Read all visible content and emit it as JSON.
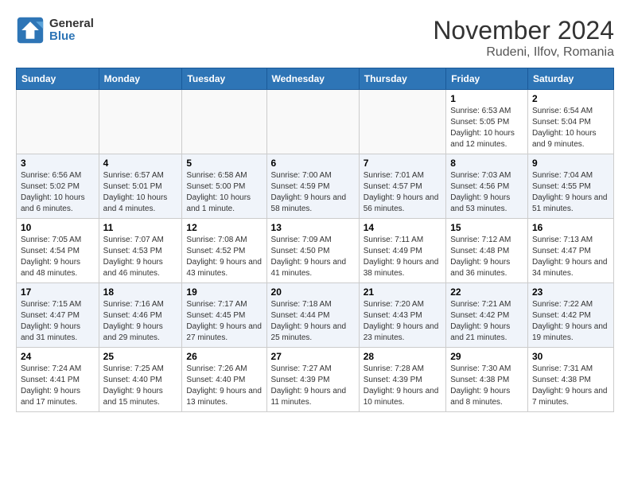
{
  "logo": {
    "text_general": "General",
    "text_blue": "Blue"
  },
  "title": "November 2024",
  "location": "Rudeni, Ilfov, Romania",
  "headers": [
    "Sunday",
    "Monday",
    "Tuesday",
    "Wednesday",
    "Thursday",
    "Friday",
    "Saturday"
  ],
  "weeks": [
    [
      {
        "day": "",
        "info": ""
      },
      {
        "day": "",
        "info": ""
      },
      {
        "day": "",
        "info": ""
      },
      {
        "day": "",
        "info": ""
      },
      {
        "day": "",
        "info": ""
      },
      {
        "day": "1",
        "info": "Sunrise: 6:53 AM\nSunset: 5:05 PM\nDaylight: 10 hours and 12 minutes."
      },
      {
        "day": "2",
        "info": "Sunrise: 6:54 AM\nSunset: 5:04 PM\nDaylight: 10 hours and 9 minutes."
      }
    ],
    [
      {
        "day": "3",
        "info": "Sunrise: 6:56 AM\nSunset: 5:02 PM\nDaylight: 10 hours and 6 minutes."
      },
      {
        "day": "4",
        "info": "Sunrise: 6:57 AM\nSunset: 5:01 PM\nDaylight: 10 hours and 4 minutes."
      },
      {
        "day": "5",
        "info": "Sunrise: 6:58 AM\nSunset: 5:00 PM\nDaylight: 10 hours and 1 minute."
      },
      {
        "day": "6",
        "info": "Sunrise: 7:00 AM\nSunset: 4:59 PM\nDaylight: 9 hours and 58 minutes."
      },
      {
        "day": "7",
        "info": "Sunrise: 7:01 AM\nSunset: 4:57 PM\nDaylight: 9 hours and 56 minutes."
      },
      {
        "day": "8",
        "info": "Sunrise: 7:03 AM\nSunset: 4:56 PM\nDaylight: 9 hours and 53 minutes."
      },
      {
        "day": "9",
        "info": "Sunrise: 7:04 AM\nSunset: 4:55 PM\nDaylight: 9 hours and 51 minutes."
      }
    ],
    [
      {
        "day": "10",
        "info": "Sunrise: 7:05 AM\nSunset: 4:54 PM\nDaylight: 9 hours and 48 minutes."
      },
      {
        "day": "11",
        "info": "Sunrise: 7:07 AM\nSunset: 4:53 PM\nDaylight: 9 hours and 46 minutes."
      },
      {
        "day": "12",
        "info": "Sunrise: 7:08 AM\nSunset: 4:52 PM\nDaylight: 9 hours and 43 minutes."
      },
      {
        "day": "13",
        "info": "Sunrise: 7:09 AM\nSunset: 4:50 PM\nDaylight: 9 hours and 41 minutes."
      },
      {
        "day": "14",
        "info": "Sunrise: 7:11 AM\nSunset: 4:49 PM\nDaylight: 9 hours and 38 minutes."
      },
      {
        "day": "15",
        "info": "Sunrise: 7:12 AM\nSunset: 4:48 PM\nDaylight: 9 hours and 36 minutes."
      },
      {
        "day": "16",
        "info": "Sunrise: 7:13 AM\nSunset: 4:47 PM\nDaylight: 9 hours and 34 minutes."
      }
    ],
    [
      {
        "day": "17",
        "info": "Sunrise: 7:15 AM\nSunset: 4:47 PM\nDaylight: 9 hours and 31 minutes."
      },
      {
        "day": "18",
        "info": "Sunrise: 7:16 AM\nSunset: 4:46 PM\nDaylight: 9 hours and 29 minutes."
      },
      {
        "day": "19",
        "info": "Sunrise: 7:17 AM\nSunset: 4:45 PM\nDaylight: 9 hours and 27 minutes."
      },
      {
        "day": "20",
        "info": "Sunrise: 7:18 AM\nSunset: 4:44 PM\nDaylight: 9 hours and 25 minutes."
      },
      {
        "day": "21",
        "info": "Sunrise: 7:20 AM\nSunset: 4:43 PM\nDaylight: 9 hours and 23 minutes."
      },
      {
        "day": "22",
        "info": "Sunrise: 7:21 AM\nSunset: 4:42 PM\nDaylight: 9 hours and 21 minutes."
      },
      {
        "day": "23",
        "info": "Sunrise: 7:22 AM\nSunset: 4:42 PM\nDaylight: 9 hours and 19 minutes."
      }
    ],
    [
      {
        "day": "24",
        "info": "Sunrise: 7:24 AM\nSunset: 4:41 PM\nDaylight: 9 hours and 17 minutes."
      },
      {
        "day": "25",
        "info": "Sunrise: 7:25 AM\nSunset: 4:40 PM\nDaylight: 9 hours and 15 minutes."
      },
      {
        "day": "26",
        "info": "Sunrise: 7:26 AM\nSunset: 4:40 PM\nDaylight: 9 hours and 13 minutes."
      },
      {
        "day": "27",
        "info": "Sunrise: 7:27 AM\nSunset: 4:39 PM\nDaylight: 9 hours and 11 minutes."
      },
      {
        "day": "28",
        "info": "Sunrise: 7:28 AM\nSunset: 4:39 PM\nDaylight: 9 hours and 10 minutes."
      },
      {
        "day": "29",
        "info": "Sunrise: 7:30 AM\nSunset: 4:38 PM\nDaylight: 9 hours and 8 minutes."
      },
      {
        "day": "30",
        "info": "Sunrise: 7:31 AM\nSunset: 4:38 PM\nDaylight: 9 hours and 7 minutes."
      }
    ]
  ]
}
